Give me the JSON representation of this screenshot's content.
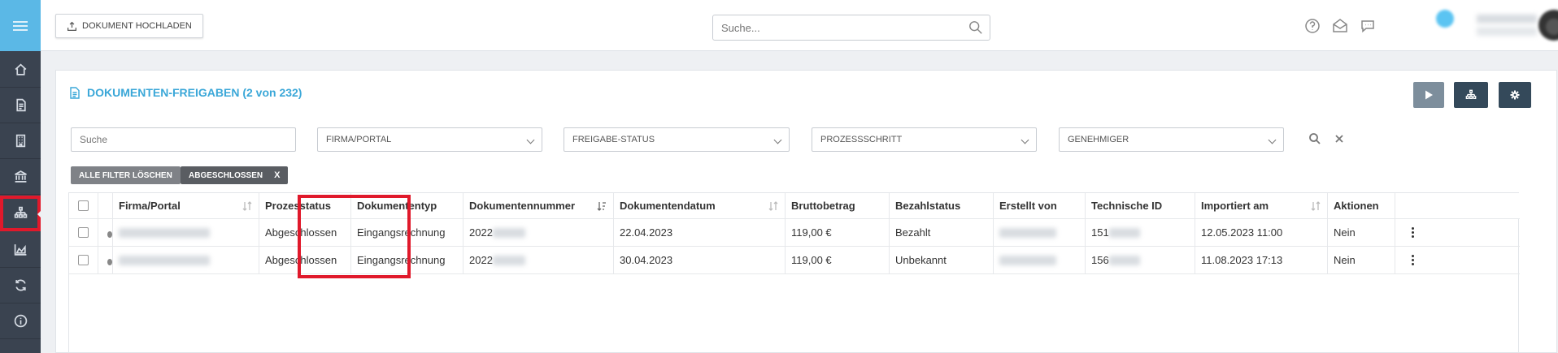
{
  "toolbar": {
    "upload_label": "DOKUMENT HOCHLADEN",
    "search_placeholder": "Suche..."
  },
  "page": {
    "title": "DOKUMENTEN-FREIGABEN (2 von 232)"
  },
  "filters": {
    "search_placeholder": "Suche",
    "firma": "FIRMA/PORTAL",
    "freigabe": "FREIGABE-STATUS",
    "prozess": "PROZESSSCHRITT",
    "genehmiger": "GENEHMIGER",
    "clear_label": "ALLE FILTER LÖSCHEN",
    "active_tag": "ABGESCHLOSSEN",
    "active_tag_remove": "X"
  },
  "colors": {
    "accent": "#3aa7d8",
    "sidebar": "#3a4350",
    "highlight": "#e0192b"
  },
  "table": {
    "columns": [
      "Firma/Portal",
      "Prozesstatus",
      "Dokumententyp",
      "Dokumentennummer",
      "Dokumentendatum",
      "Bruttobetrag",
      "Bezahlstatus",
      "Erstellt von",
      "Technische ID",
      "Importiert am",
      "Aktionen"
    ],
    "rows": [
      {
        "prozesstatus": "Abgeschlossen",
        "dokumententyp": "Eingangsrechnung",
        "dokumentennummer": "2022",
        "dokumentendatum": "22.04.2023",
        "bruttobetrag": "119,00 €",
        "bezahlstatus": "Bezahlt",
        "technische_id": "151",
        "importiert_am": "12.05.2023 11:00",
        "aktionen": "Nein"
      },
      {
        "prozesstatus": "Abgeschlossen",
        "dokumententyp": "Eingangsrechnung",
        "dokumentennummer": "2022",
        "dokumentendatum": "30.04.2023",
        "bruttobetrag": "119,00 €",
        "bezahlstatus": "Unbekannt",
        "technische_id": "156",
        "importiert_am": "11.08.2023 17:13",
        "aktionen": "Nein"
      }
    ]
  }
}
